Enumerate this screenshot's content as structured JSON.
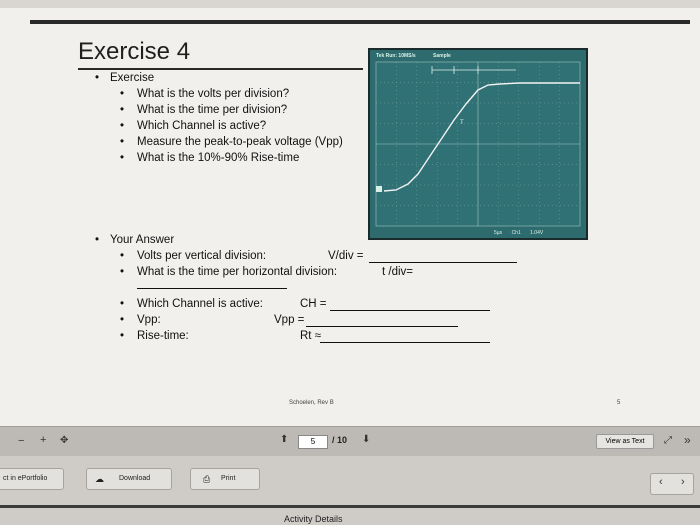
{
  "slide": {
    "title": "Exercise 4",
    "exercise": {
      "heading": "Exercise",
      "items": [
        "What is the volts per division?",
        "What is the time per division?",
        "Which Channel is active?",
        "Measure the peak-to-peak voltage (Vpp)",
        "What is the 10%-90% Rise-time"
      ]
    },
    "scope": {
      "header_left": "Tek Run: 10MS/s",
      "header_right": "Sample",
      "footer_ch": "Ch1",
      "footer_sample": "5µs",
      "footer_volt": "1.04V"
    },
    "answer": {
      "heading": "Your Answer",
      "volts_label": "Volts per vertical division:",
      "volts_unit": "V/div =",
      "time_label": "What is the time per horizontal division:",
      "time_unit": "t /div=",
      "channel_label": "Which Channel is active:",
      "channel_unit": "CH =",
      "vpp_label": "Vpp:",
      "vpp_unit": "Vpp =",
      "rise_label": "Rise-time:",
      "rise_unit": "Rt ≈"
    },
    "footer": "Schoelen, Rev B",
    "page_number": "5"
  },
  "toolbar": {
    "zoom_out": "−",
    "zoom_in": "+",
    "fit": "✥",
    "current_page": "5",
    "total_pages": "/ 10",
    "view_as_text": "View as Text",
    "expand": "⤢",
    "more": "»"
  },
  "bottom": {
    "eportfolio": "ct in ePortfolio",
    "download": "Download",
    "print": "Print",
    "prev": "‹",
    "next": "›",
    "activity": "Activity Details"
  }
}
